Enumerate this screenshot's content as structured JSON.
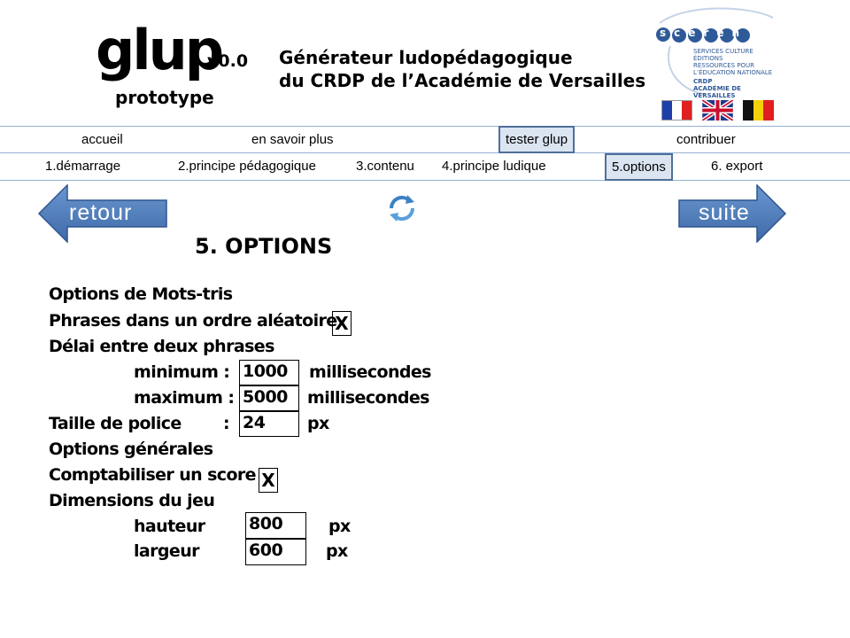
{
  "header": {
    "logo": "glup",
    "version": "v0.0",
    "subtitle": "prototype",
    "title_line1": "Générateur ludopédagogique",
    "title_line2": "du CRDP de l’Académie de Versailles",
    "partner": {
      "logo_text": "scérén",
      "tagline": [
        "SERVICES CULTURE ÉDITIONS",
        "RESSOURCES POUR",
        "L’ÉDUCATION NATIONALE"
      ],
      "org": [
        "CRDP",
        "ACADÉMIE DE VERSAILLES"
      ]
    },
    "flags": [
      "france",
      "united-kingdom",
      "belgium"
    ]
  },
  "main_nav": [
    "accueil",
    "en savoir plus",
    "tester glup",
    "contribuer"
  ],
  "main_nav_active": "tester glup",
  "steps_nav": [
    "1.démarrage",
    "2.principe pédagogique",
    "3.contenu",
    "4.principe ludique",
    "5.options",
    "6. export"
  ],
  "steps_nav_active": "5.options",
  "buttons": {
    "back": "retour",
    "next": "suite"
  },
  "page_title": "5. OPTIONS",
  "mots_tris": {
    "heading": "Options de Mots-tris",
    "random_label": "Phrases dans un ordre aléatoire",
    "random_checked": "X",
    "delay_label": "Délai entre deux phrases",
    "min_label": "minimum :",
    "min_value": "1000",
    "max_label": "maximum :",
    "max_value": "5000",
    "delay_unit": "millisecondes",
    "font_label": "Taille de police",
    "font_colon": ":",
    "font_value": "24",
    "font_unit": "px"
  },
  "general": {
    "heading": "Options générales",
    "score_label": "Comptabiliser un score",
    "score_checked": "X",
    "dims_label": "Dimensions du jeu",
    "height_label": "hauteur",
    "height_value": "800",
    "width_label": "largeur",
    "width_value": "600",
    "unit": "px"
  },
  "colors": {
    "accent": "#4f81bd",
    "nav_line": "#95b3d7",
    "active_bg": "#dbe5f1"
  }
}
